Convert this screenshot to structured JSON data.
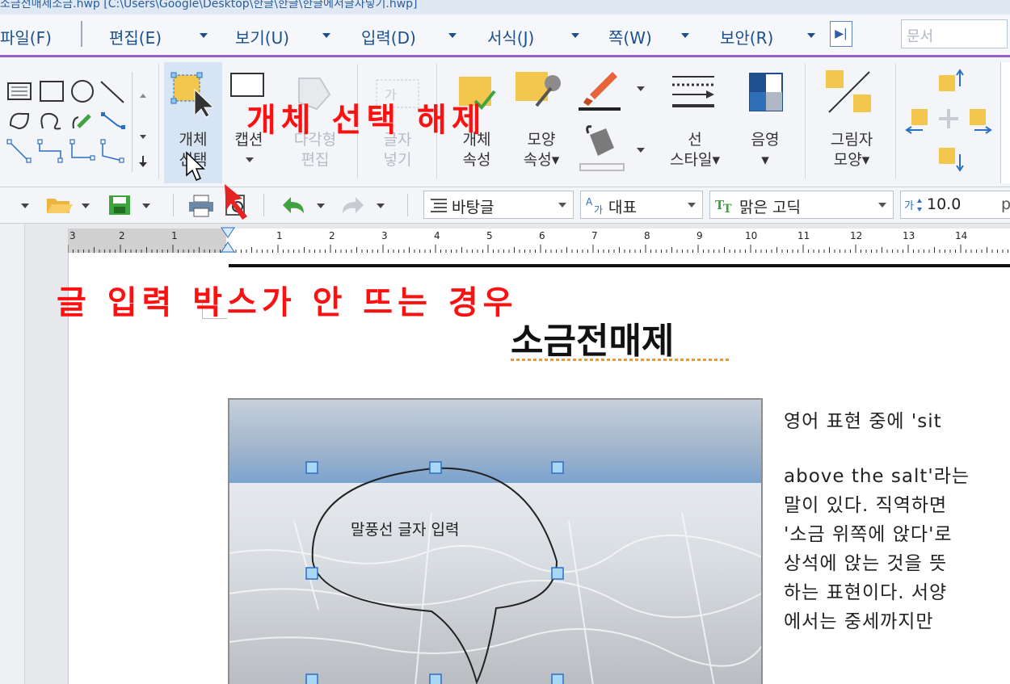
{
  "window": {
    "title": "소금전매제소금.hwp [C:\\Users\\Google\\Desktop\\한글\\한글\\한글에서글자넣기.hwp]"
  },
  "menu": {
    "items": [
      {
        "label": "파일(F)",
        "has_caret": false
      },
      {
        "label": "편집(E)",
        "has_caret": true
      },
      {
        "label": "보기(U)",
        "has_caret": true
      },
      {
        "label": "입력(D)",
        "has_caret": true
      },
      {
        "label": "서식(J)",
        "has_caret": true
      },
      {
        "label": "쪽(W)",
        "has_caret": true
      },
      {
        "label": "보안(R)",
        "has_caret": true
      }
    ],
    "expand_icon": "double-chevron-right-icon",
    "search_placeholder": "문서"
  },
  "ribbon": {
    "object_select": {
      "line1": "개체",
      "line2": "선택"
    },
    "caption": {
      "line1": "캡션"
    },
    "polygon_edit": {
      "line1": "다각형",
      "line2": "편집"
    },
    "insert_text": {
      "line1": "글자",
      "line2": "넣기"
    },
    "object_props": {
      "line1": "개체",
      "line2": "속성"
    },
    "shape_props": {
      "line1": "모양",
      "line2": "속성▾"
    },
    "line_style": {
      "line1": "선",
      "line2": "스타일▾"
    },
    "shading": {
      "line1": "음영",
      "line2": "▾"
    },
    "shadow": {
      "line1": "그림자",
      "line2": "모양▾"
    }
  },
  "toolbar": {
    "paragraph_style": "바탕글",
    "font_lang": "대표",
    "font_name": "맑은 고딕",
    "font_size": "10.0",
    "font_size_unit": "p"
  },
  "ruler": {
    "ticks_left": [
      "3",
      "2",
      "1"
    ],
    "ticks_right": [
      "1",
      "2",
      "3",
      "4",
      "5",
      "6",
      "7",
      "8",
      "9",
      "10",
      "11",
      "12",
      "13",
      "14"
    ]
  },
  "annotations": {
    "object_deselect": "개체 선택 해제",
    "no_input_box": "글 입력 박스가 안 뜨는 경우"
  },
  "document": {
    "title": "소금전매제",
    "balloon_text": "말풍선 글자 입력",
    "body_lines": [
      "영어 표현 중에 'sit",
      "above the salt'라는",
      "말이 있다. 직역하면",
      "'소금 위쪽에 앉다'로",
      "상석에 앉는 것을 뜻",
      "하는 표현이다. 서양",
      "에서는 중세까지만"
    ]
  },
  "colors": {
    "menu_text": "#1d4f8c",
    "accent_purple": "#9c5ec7",
    "annotation_red": "#ff1010",
    "select_highlight": "#d7e4f3"
  }
}
